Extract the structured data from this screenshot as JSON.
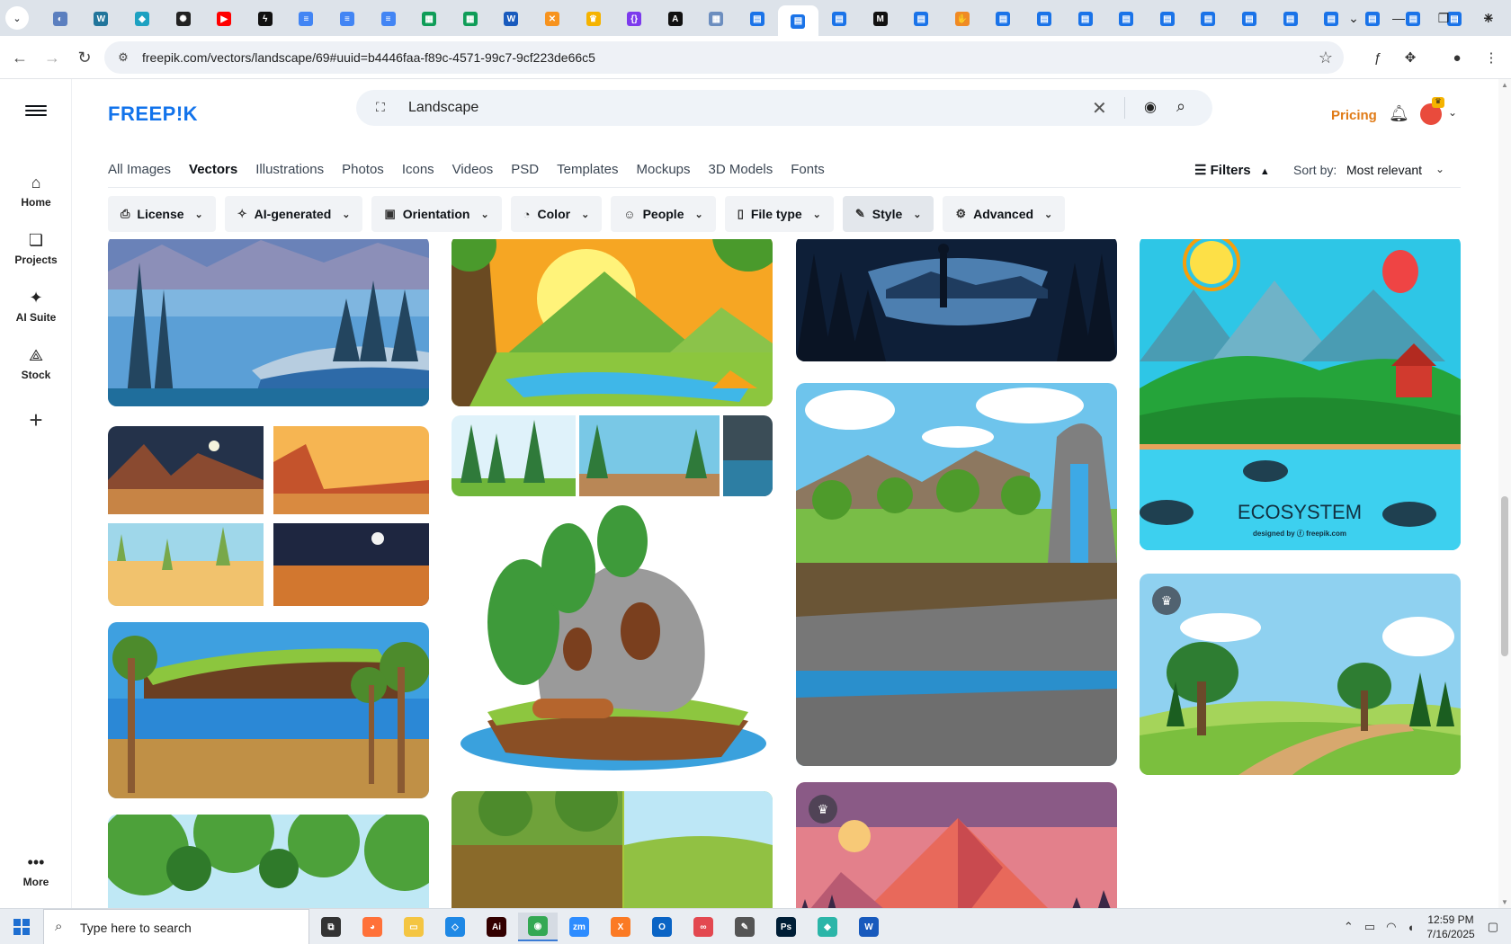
{
  "browser": {
    "url": "freepik.com/vectors/landscape/69#uuid=b4446faa-f89c-4571-99c7-9cf223de66c5",
    "tabs": [
      {
        "icon": "globe-icon",
        "color": "#5b7fbf"
      },
      {
        "icon": "wordpress-icon",
        "color": "#21759b"
      },
      {
        "icon": "edge-like-icon",
        "color": "#1da1c1"
      },
      {
        "icon": "openai-icon",
        "color": "#222222"
      },
      {
        "icon": "youtube-icon",
        "color": "#ff0000"
      },
      {
        "icon": "bolt-icon",
        "color": "#111111"
      },
      {
        "icon": "docs-icon",
        "color": "#4285f4"
      },
      {
        "icon": "docs-icon",
        "color": "#4285f4"
      },
      {
        "icon": "docs-icon",
        "color": "#4285f4"
      },
      {
        "icon": "sheets-icon",
        "color": "#0f9d58"
      },
      {
        "icon": "sheets-icon",
        "color": "#0f9d58"
      },
      {
        "icon": "word-icon",
        "color": "#185abd"
      },
      {
        "icon": "x-box-icon",
        "color": "#f7931e"
      },
      {
        "icon": "crown-icon",
        "color": "#f5b300"
      },
      {
        "icon": "braces-icon",
        "color": "#7c3aed"
      },
      {
        "icon": "a-icon",
        "color": "#111111"
      },
      {
        "icon": "grid-icon",
        "color": "#6c8ebf"
      },
      {
        "icon": "form-icon",
        "color": "#1a73e8"
      },
      {
        "icon": "form-icon",
        "color": "#1a73e8"
      },
      {
        "icon": "form-icon",
        "color": "#1a73e8"
      },
      {
        "icon": "medium-icon",
        "color": "#111111"
      },
      {
        "icon": "form-icon",
        "color": "#1a73e8"
      },
      {
        "icon": "hand-icon",
        "color": "#f08a24"
      },
      {
        "icon": "form-icon",
        "color": "#1a73e8"
      },
      {
        "icon": "form-icon",
        "color": "#1a73e8"
      },
      {
        "icon": "form-icon",
        "color": "#1a73e8"
      },
      {
        "icon": "form-icon",
        "color": "#1a73e8"
      },
      {
        "icon": "form-icon",
        "color": "#1a73e8"
      },
      {
        "icon": "form-icon",
        "color": "#1a73e8"
      },
      {
        "icon": "form-icon",
        "color": "#1a73e8"
      },
      {
        "icon": "form-icon",
        "color": "#1a73e8"
      },
      {
        "icon": "form-icon",
        "color": "#1a73e8"
      },
      {
        "icon": "form-icon",
        "color": "#1a73e8"
      },
      {
        "icon": "form-icon",
        "color": "#1a73e8"
      },
      {
        "icon": "form-icon",
        "color": "#1a73e8"
      }
    ],
    "active_tab_index": 18
  },
  "sidebar": {
    "items": [
      {
        "label": "Home",
        "icon": "home-icon"
      },
      {
        "label": "Projects",
        "icon": "projects-icon"
      },
      {
        "label": "AI Suite",
        "icon": "sparkle-icon"
      },
      {
        "label": "Stock",
        "icon": "stock-icon"
      }
    ],
    "more_label": "More"
  },
  "header": {
    "logo": "FREEP!K",
    "search_value": "Landscape",
    "pricing": "Pricing"
  },
  "categories": [
    "All Images",
    "Vectors",
    "Illustrations",
    "Photos",
    "Icons",
    "Videos",
    "PSD",
    "Templates",
    "Mockups",
    "3D Models",
    "Fonts"
  ],
  "active_category": "Vectors",
  "filters_label": "Filters",
  "sort": {
    "label": "Sort by:",
    "value": "Most relevant"
  },
  "chips": [
    {
      "label": "License",
      "icon": "license-icon"
    },
    {
      "label": "AI-generated",
      "icon": "ai-icon"
    },
    {
      "label": "Orientation",
      "icon": "orientation-icon"
    },
    {
      "label": "Color",
      "icon": "palette-icon"
    },
    {
      "label": "People",
      "icon": "people-icon"
    },
    {
      "label": "File type",
      "icon": "file-icon"
    },
    {
      "label": "Style",
      "icon": "brush-icon"
    },
    {
      "label": "Advanced",
      "icon": "gear-icon"
    }
  ],
  "active_chip": "Style",
  "gallery": {
    "ecosystem_text": "ECOSYSTEM",
    "designed_by": "designed by ⓕ freepik.com"
  },
  "taskbar": {
    "search_placeholder": "Type here to search",
    "time": "12:59 PM",
    "date": "7/16/2025",
    "apps": [
      {
        "icon": "task-view-icon",
        "color": "#333333"
      },
      {
        "icon": "firefox-icon",
        "color": "#ff7139"
      },
      {
        "icon": "file-explorer-icon",
        "color": "#f4c542"
      },
      {
        "icon": "vscode-icon",
        "color": "#1e88e5"
      },
      {
        "icon": "illustrator-icon",
        "color": "#330000"
      },
      {
        "icon": "chrome-icon",
        "color": "#34a853"
      },
      {
        "icon": "zoom-icon",
        "color": "#2d8cff"
      },
      {
        "icon": "xampp-icon",
        "color": "#fb7a24"
      },
      {
        "icon": "outlook-icon",
        "color": "#0a64c5"
      },
      {
        "icon": "creative-cloud-icon",
        "color": "#e34850"
      },
      {
        "icon": "pen-icon",
        "color": "#555555"
      },
      {
        "icon": "photoshop-icon",
        "color": "#001e36"
      },
      {
        "icon": "app-gem-icon",
        "color": "#2bb5a8"
      },
      {
        "icon": "word-icon",
        "color": "#185abd"
      }
    ],
    "active_app_index": 5
  }
}
